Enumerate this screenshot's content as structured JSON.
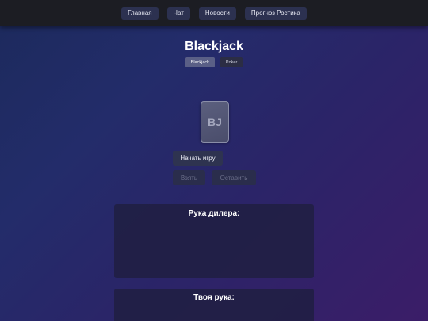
{
  "nav": {
    "items": [
      {
        "label": "Главная"
      },
      {
        "label": "Чат"
      },
      {
        "label": "Новости"
      },
      {
        "label": "Прогноз Ростика"
      }
    ]
  },
  "game": {
    "title": "Blackjack",
    "tabs": [
      {
        "label": "Blackjack",
        "active": true
      },
      {
        "label": "Poker",
        "active": false
      }
    ],
    "logo_text": "BJ",
    "buttons": {
      "start": "Начать игру",
      "hit": "Взять",
      "stand": "Оставить"
    },
    "dealer_hand_title": "Рука дилера:",
    "player_hand_title": "Твоя рука:"
  },
  "colors": {
    "topbar": "#1c1d23",
    "nav_button": "#2c3150",
    "background_start": "#1c2a5c",
    "background_end": "#3b1d68",
    "panel": "#201f42"
  }
}
